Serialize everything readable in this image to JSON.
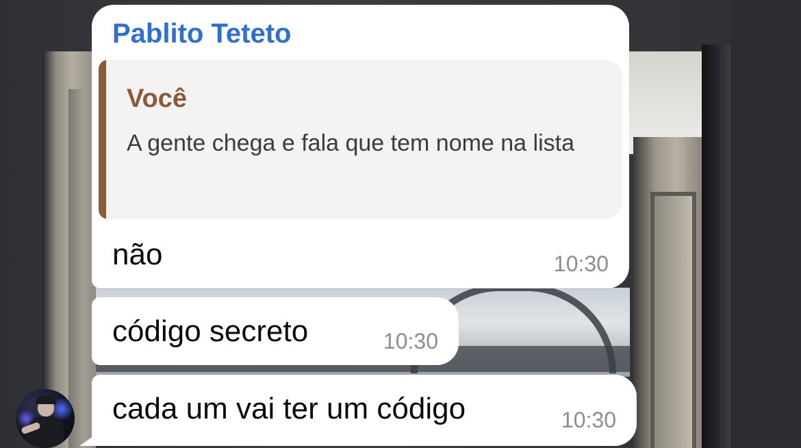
{
  "chat": {
    "sender_name": "Pablito Teteto",
    "reply": {
      "author": "Você",
      "text": "A gente chega e fala que tem nome na lista"
    },
    "messages": [
      {
        "text": "não",
        "time": "10:30"
      },
      {
        "text": "código secreto",
        "time": "10:30"
      },
      {
        "text": "cada um vai ter um código",
        "time": "10:30"
      }
    ]
  },
  "colors": {
    "sender_name": "#2e6fcf",
    "reply_accent": "#8a5a3b",
    "bubble_background": "#ffffff",
    "time_text": "#8d8d8d"
  },
  "icons": {
    "avatar": "contact-avatar-photo"
  }
}
